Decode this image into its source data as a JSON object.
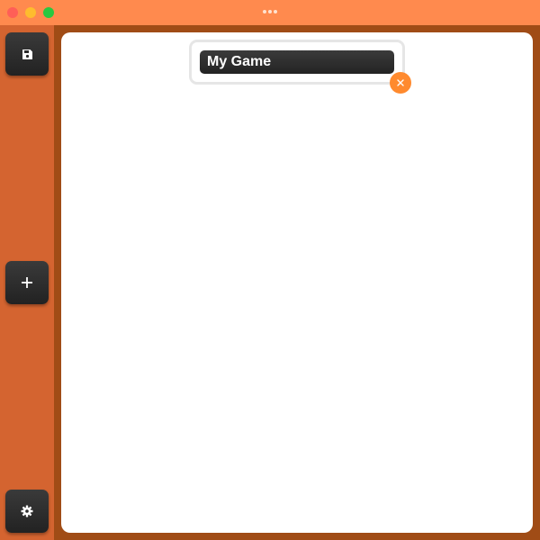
{
  "window": {
    "controls": [
      "close",
      "minimize",
      "maximize"
    ],
    "title_icon": "more-dots-icon"
  },
  "sidebar": {
    "buttons": [
      {
        "name": "save",
        "icon": "floppy-disk-icon"
      },
      {
        "name": "add",
        "icon": "plus-icon"
      },
      {
        "name": "settings",
        "icon": "gear-icon"
      }
    ]
  },
  "editor": {
    "name_field": {
      "value": "My Game",
      "placeholder": ""
    },
    "close_icon": "close-x-icon"
  },
  "colors": {
    "titlebar": "#ff8a4e",
    "sidebar": "#d46430",
    "frame": "#a04c16",
    "accent": "#ff8a2e",
    "button": "#2b2b2b",
    "canvas": "#ffffff"
  }
}
